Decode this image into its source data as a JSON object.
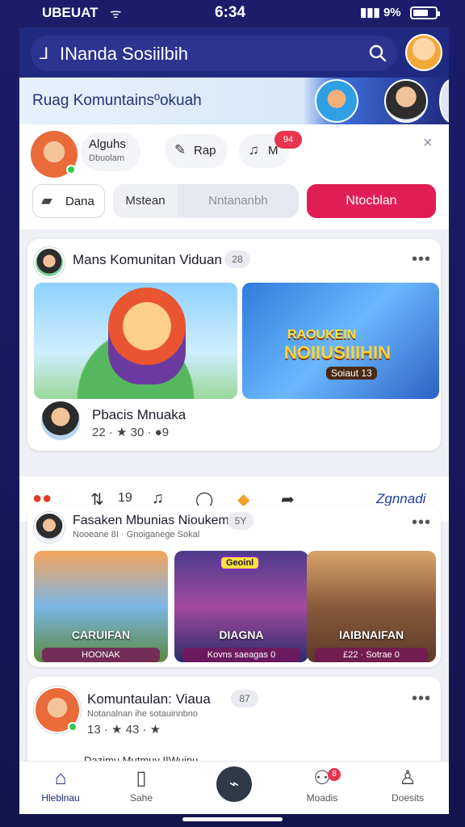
{
  "status": {
    "carrier": "UBEUAT",
    "time": "6:34",
    "right": "9%",
    "battery_level": 0.7
  },
  "topbar": {
    "title": "INanda Sosiilbih",
    "icons": {
      "back": "back-icon",
      "search": "search-icon",
      "avatar": "avatar"
    }
  },
  "banner": {
    "title": "Ruag Komuntainsºokuah"
  },
  "composer": {
    "name": "Alguhs",
    "subtitle": "Dbuolam",
    "pill1": "Rap",
    "pill2": "M",
    "badge": "94",
    "btn1": "Dana",
    "seg1": "Mstean",
    "seg2": "Nntananbh",
    "cta": "Ntocblan",
    "close": "×"
  },
  "posts": [
    {
      "title": "Mans Komunitan Viduan",
      "badge": "28",
      "game_title_1": "RAOUKEIN",
      "game_title_2": "NOIIUSIIIHIN",
      "game_sub": "Soiaut 13",
      "poster_title": "Pbacis Mnuaka",
      "meta": "22 · ★ 30 · ●9"
    },
    {
      "title": "Fasaken Mbunias Nioukem",
      "subtitle": "Nooeane 8I · Gnoiganege Sokal",
      "badge": "5Y",
      "thumbs": [
        {
          "caption": "CARUIFAN",
          "sub": "HOONAK",
          "tag": ""
        },
        {
          "caption": "DIAGNA",
          "sub": "Kovns saeagas 0",
          "tag": "Geoinl"
        },
        {
          "caption": "IAIBNAIFAN",
          "sub": "£22 · Sotrae 0",
          "tag": ""
        }
      ]
    },
    {
      "title": "Komuntaulan: Viaua",
      "subtitle": "Notanalnan ihe sotauinnbno",
      "badge": "87",
      "meta": "13 · ★ 43 · ★"
    }
  ],
  "actions": {
    "reactions": "●●",
    "share_count": "19",
    "link": "Zgnnadi"
  },
  "peek": {
    "title": "Dazimu Mutmuv IIWuinu"
  },
  "tabbar": [
    {
      "label": "Hleblnau",
      "icon": "home-icon",
      "active": true
    },
    {
      "label": "Sahe",
      "icon": "book-icon",
      "active": false
    },
    {
      "label": "",
      "icon": "compose-icon",
      "active": false
    },
    {
      "label": "Moadis",
      "icon": "people-icon",
      "badge": "8",
      "active": false
    },
    {
      "label": "Doesits",
      "icon": "person-icon",
      "active": false
    }
  ]
}
